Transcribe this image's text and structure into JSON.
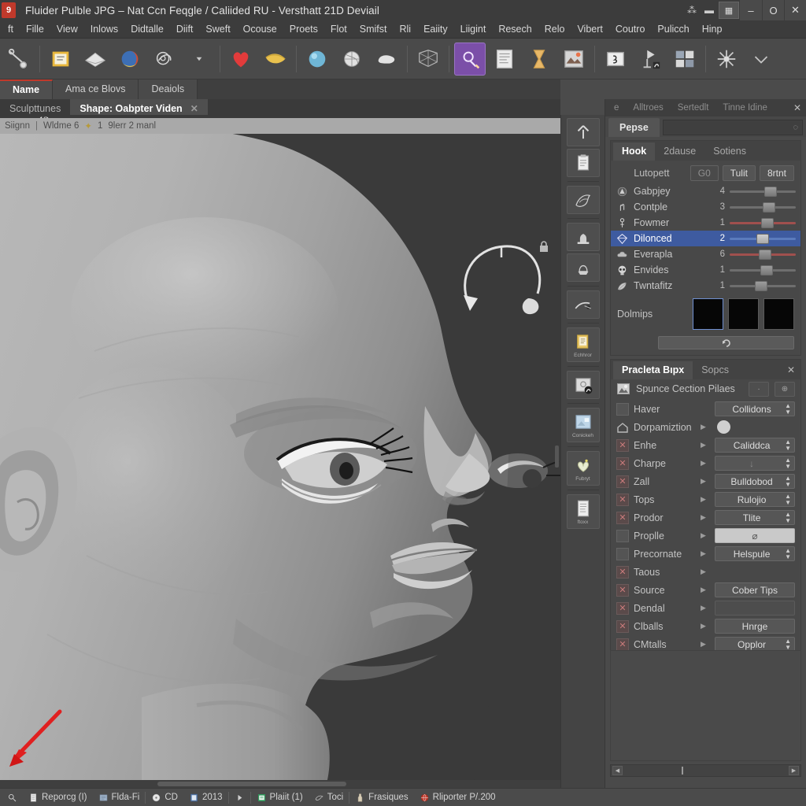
{
  "window": {
    "title": "Fluider Pulble JPG – Nat Ccn Feqgle / Caliided RU - Versthatt 21D Deviail",
    "app_badge": "9",
    "controls": {
      "minimize": "–",
      "maximize": "O",
      "close": "✕",
      "pin": "⁂",
      "dash": "▬",
      "grid": "▦"
    }
  },
  "menu": {
    "items": [
      "ft",
      "Fille",
      "View",
      "Inlows",
      "Didtalle",
      "Diift",
      "Sweft",
      "Ocouse",
      "Proets",
      "Flot",
      "Smifst",
      "Rli",
      "Eaiity",
      "Liigint",
      "Resech",
      "Relo",
      "Vibert",
      "Coutro",
      "Pulicch",
      "Hinp"
    ]
  },
  "toolbar": {
    "icons": [
      "sculpt-tool-icon",
      "folder-icon",
      "plane-icon",
      "material-ball-icon",
      "orbit-icon",
      "arrow-small-icon",
      "heart-icon",
      "curve-icon",
      "sphere-icon",
      "grid-sphere-icon",
      "blob-icon",
      "mesh-wire-icon",
      "brush-active-icon",
      "document-icon",
      "hourglass-icon",
      "image-thumb-icon",
      "textbox-icon",
      "light-stand-icon",
      "quad-grid-icon",
      "spider-icon",
      "chevron-down-icon"
    ],
    "active_index": 12
  },
  "tabs_primary": {
    "items": [
      {
        "label": "Name",
        "selected": true
      },
      {
        "label": "Ama ce Blovs",
        "selected": false
      },
      {
        "label": "Deaiols",
        "selected": false
      }
    ]
  },
  "tabs_secondary": {
    "items": [
      {
        "label": "Sculpttunes",
        "selected": false
      },
      {
        "label": "Shape: Oabpter Viden",
        "selected": true,
        "close": "✕"
      }
    ]
  },
  "breadcrumb": {
    "parts": [
      "Siignn",
      "Wldme 6",
      "1",
      "9lerr 2 manl"
    ],
    "dot": "|",
    "star": "✦"
  },
  "viewport": {
    "gizmo_value": "43",
    "gizmo_name": "rotation-gizmo",
    "annotation": "red-arrow-annotation",
    "lock_icon": "lock-icon",
    "model": "sculpted-head-profile"
  },
  "vstrip": {
    "tools": [
      {
        "icon": "up-arrow-icon",
        "label": ""
      },
      {
        "icon": "clipboard-icon",
        "label": ""
      },
      {
        "icon": "sketch-icon",
        "label": ""
      },
      {
        "icon": "stamp-icon",
        "label": ""
      },
      {
        "icon": "anvil-icon",
        "label": ""
      },
      {
        "icon": "spray-icon",
        "label": ""
      },
      {
        "icon": "folder-note-icon",
        "label": "Echhror"
      },
      {
        "icon": "frame-icon",
        "label": ""
      },
      {
        "icon": "photo-icon",
        "label": "Conickeh"
      },
      {
        "icon": "plant-icon",
        "label": "Fubryt"
      },
      {
        "icon": "page-icon",
        "label": "ftoxx"
      }
    ]
  },
  "right_panel": {
    "topbar": {
      "tabs": [
        "e",
        "Alltroes",
        "Sertedlt",
        "Tinne Idine"
      ],
      "close": "✕"
    },
    "subbar": {
      "tab": "Pepse",
      "field_value": "",
      "field_icon": "◌"
    },
    "hook_section": {
      "tabs": [
        {
          "label": "Hook",
          "selected": true
        },
        {
          "label": "2dause",
          "selected": false
        },
        {
          "label": "Sotiens",
          "selected": false
        }
      ],
      "button_row": {
        "label": "Lutopett",
        "buttons": [
          {
            "label": "G0",
            "dim": true
          },
          {
            "label": "Tulit",
            "dim": false
          },
          {
            "label": "8rtnt",
            "dim": false
          }
        ]
      },
      "sliders": [
        {
          "icon": "cone-icon",
          "name": "Gabpjey",
          "value": "4",
          "pos": 52,
          "track": "grey",
          "selected": false
        },
        {
          "icon": "hand-icon",
          "name": "Contple",
          "value": "3",
          "pos": 50,
          "track": "grey",
          "selected": false
        },
        {
          "icon": "pin-icon",
          "name": "Fowmer",
          "value": "1",
          "pos": 48,
          "track": "red",
          "selected": false
        },
        {
          "icon": "diamond-icon",
          "name": "Dilonced",
          "value": "2",
          "pos": 40,
          "track": "blue",
          "selected": true
        },
        {
          "icon": "cloud-icon",
          "name": "Everapla",
          "value": "6",
          "pos": 44,
          "track": "red",
          "selected": false
        },
        {
          "icon": "skull-icon",
          "name": "Envides",
          "value": "1",
          "pos": 46,
          "track": "grey",
          "selected": false
        },
        {
          "icon": "leaf-icon",
          "name": "Twntafitz",
          "value": "1",
          "pos": 38,
          "track": "grey",
          "selected": false
        }
      ],
      "swatch_row": {
        "label": "Dolmips",
        "count": 3,
        "selected_index": 0
      },
      "wide_button": "refresh-icon"
    },
    "props_section": {
      "tabs": [
        {
          "label": "Pracleta Bıpx",
          "selected": true
        },
        {
          "label": "Sopcs",
          "selected": false
        }
      ],
      "close": "✕",
      "header": {
        "icon": "scene-icon",
        "text": "Spunce Cection Pilaes",
        "btn_a": "·",
        "btn_b": "⊕"
      },
      "rows": [
        {
          "check": "plain",
          "name": "Haver",
          "arrow": false,
          "control": "dropdown",
          "value": "Collidons"
        },
        {
          "check": "home",
          "name": "Dorpamiztion",
          "arrow": true,
          "control": "circle",
          "value": ""
        },
        {
          "check": "marked",
          "name": "Enhe",
          "arrow": true,
          "control": "dropdown",
          "value": "Caliddca"
        },
        {
          "check": "marked",
          "name": "Charpe",
          "arrow": true,
          "control": "dropdown-dim",
          "value": "↓"
        },
        {
          "check": "marked",
          "name": "Zall",
          "arrow": true,
          "control": "dropdown",
          "value": "Bulldobod"
        },
        {
          "check": "marked",
          "name": "Tops",
          "arrow": true,
          "control": "dropdown",
          "value": "Rulojio"
        },
        {
          "check": "marked",
          "name": "Prodor",
          "arrow": true,
          "control": "dropdown",
          "value": "Tlite"
        },
        {
          "check": "plain",
          "name": "Proplle",
          "arrow": true,
          "control": "light",
          "value": "⌀"
        },
        {
          "check": "plain",
          "name": "Precornate",
          "arrow": true,
          "control": "dropdown",
          "value": "Helspule"
        },
        {
          "check": "marked",
          "name": "Taous",
          "arrow": true,
          "control": "none",
          "value": ""
        },
        {
          "check": "marked",
          "name": "Source",
          "arrow": true,
          "control": "button",
          "value": "Cober Tips"
        },
        {
          "check": "marked",
          "name": "Dendal",
          "arrow": true,
          "control": "empty",
          "value": ""
        },
        {
          "check": "marked",
          "name": "Clballs",
          "arrow": true,
          "control": "button",
          "value": "Hnrge"
        },
        {
          "check": "marked",
          "name": "CMtalls",
          "arrow": true,
          "control": "dropdown",
          "value": "Opplor"
        }
      ]
    }
  },
  "statusbar": {
    "items": [
      {
        "icon": "search-icon",
        "label": ""
      },
      {
        "icon": "page-icon",
        "label": "Reporcg (I)"
      },
      {
        "icon": "archive-icon",
        "label": "Flda-Fi"
      },
      {
        "icon": "disc-icon",
        "label": "CD"
      },
      {
        "icon": "book-icon",
        "label": "2013"
      },
      {
        "icon": "play-icon",
        "label": ""
      },
      {
        "icon": "sheet-icon",
        "label": "Plaiit (1)"
      },
      {
        "icon": "bird-icon",
        "label": "Toci"
      },
      {
        "icon": "bottle-icon",
        "label": "Frasiques"
      },
      {
        "icon": "globe-icon",
        "label": "Rliporter P/.200"
      }
    ]
  },
  "colors": {
    "accent_purple": "#7b4fa8",
    "selection_blue": "#3e5ba0",
    "tab_red": "#c0392b",
    "panel_bg": "#4a4a4a",
    "viewport_bg": "#3a3a3a",
    "annotation_red": "#e02020"
  }
}
